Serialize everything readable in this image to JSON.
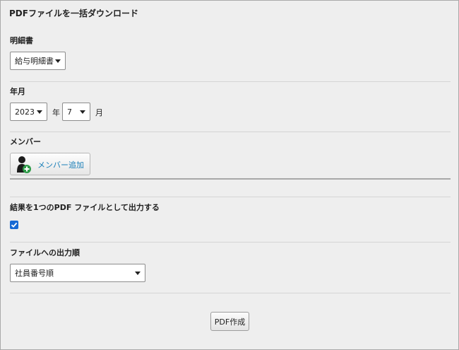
{
  "page": {
    "title": "PDFファイルを一括ダウンロード"
  },
  "statement": {
    "label": "明細書",
    "selected": "給与明細書"
  },
  "period": {
    "label": "年月",
    "year": "2023",
    "year_unit": "年",
    "month": "7",
    "month_unit": "月"
  },
  "members": {
    "label": "メンバー",
    "add_button_label": "メンバー追加",
    "icon": "add-person-icon"
  },
  "single_pdf": {
    "label": "結果を1つのPDF ファイルとして出力する",
    "checked": true
  },
  "output_order": {
    "label": "ファイルへの出力順",
    "selected": "社員番号順"
  },
  "actions": {
    "create_pdf_label": "PDF作成"
  },
  "colors": {
    "accent": "#1a7fb8",
    "checkbox": "#1769d4",
    "panel_bg": "#eeeeee"
  }
}
